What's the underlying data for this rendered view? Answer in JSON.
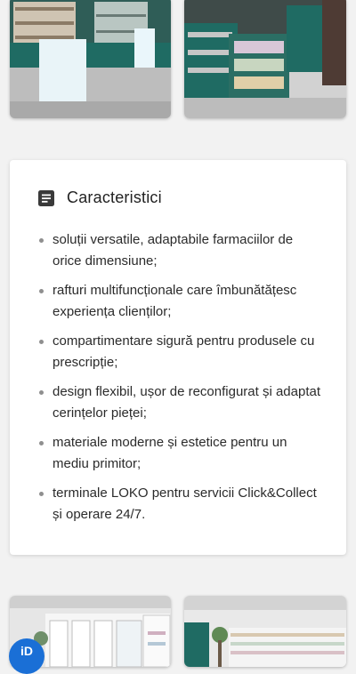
{
  "images": {
    "top_left": {
      "label": "pharmacy-interior-counter-image"
    },
    "top_right": {
      "label": "pharmacy-interior-shelves-image"
    },
    "bottom_left": {
      "label": "pharmacy-interior-white-shelves-image"
    },
    "bottom_right": {
      "label": "pharmacy-interior-green-shelves-image"
    }
  },
  "characteristics": {
    "icon": "document-icon",
    "title": "Caracteristici",
    "items": [
      "soluții versatile, adaptabile farmaciilor de orice dimensiune;",
      "rafturi multifuncționale care îmbunătățesc experiența clienților;",
      "compartimentare sigură pentru produsele cu prescripție;",
      "design flexibil, ușor de reconfigurat și adaptat cerințelor pieței;",
      "materiale moderne și estetice pentru un mediu primitor;",
      "terminale LOKO pentru servicii Click&Collect și operare 24/7."
    ]
  },
  "badge": {
    "label": "iD"
  },
  "colors": {
    "accent": "#1a6fd6",
    "teal": "#1f6b63",
    "background": "#f2f2f2"
  }
}
